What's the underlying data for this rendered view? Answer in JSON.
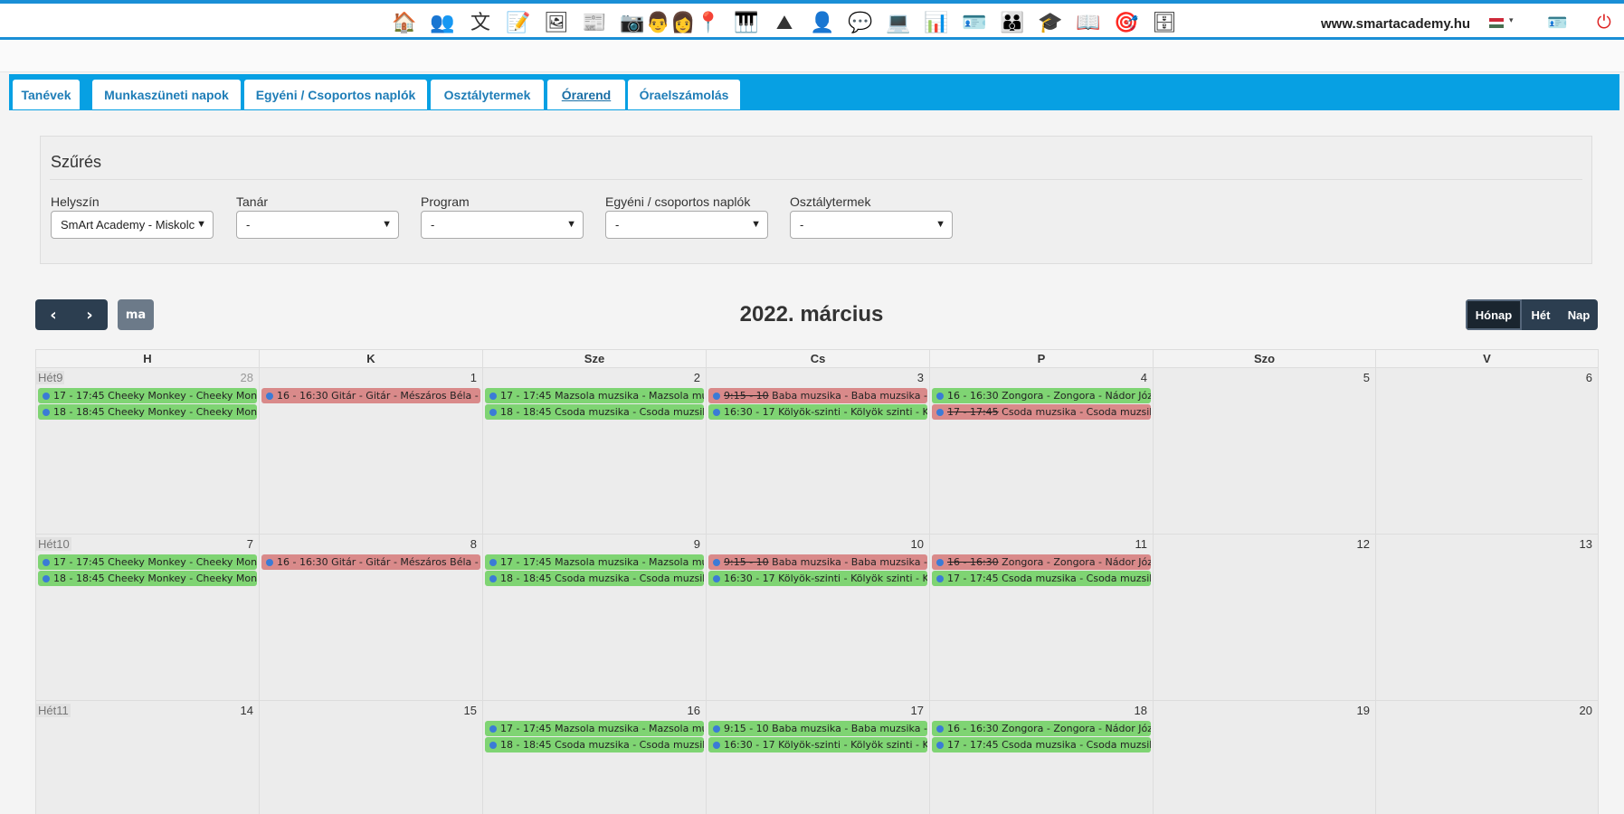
{
  "header": {
    "site": "www.smartacademy.hu",
    "apps": [
      {
        "icon": "school-icon",
        "glyph": "🏠"
      },
      {
        "icon": "users-icon",
        "glyph": "👥"
      },
      {
        "icon": "translate-icon",
        "glyph": "文"
      },
      {
        "icon": "documents-icon",
        "glyph": "📝"
      },
      {
        "icon": "slideshow-icon",
        "glyph": "🖼"
      },
      {
        "icon": "newspaper-icon",
        "glyph": "📰"
      },
      {
        "icon": "camera-icon",
        "glyph": "📷"
      },
      {
        "icon": "user-group-icon",
        "glyph": "👨‍👩"
      },
      {
        "icon": "location-pin-icon",
        "glyph": "📍"
      },
      {
        "icon": "piano-icon",
        "glyph": "🎹"
      },
      {
        "icon": "landscape-icon",
        "glyph": "⛰"
      },
      {
        "icon": "user-outline-icon",
        "glyph": "👤"
      },
      {
        "icon": "chat-bubble-icon",
        "glyph": "💬"
      },
      {
        "icon": "computer-user-icon",
        "glyph": "💻"
      },
      {
        "icon": "presentation-icon",
        "glyph": "📊"
      },
      {
        "icon": "id-badge-icon",
        "glyph": "🪪"
      },
      {
        "icon": "family-icon",
        "glyph": "👪"
      },
      {
        "icon": "graduate-icon",
        "glyph": "🎓"
      },
      {
        "icon": "book-icon",
        "glyph": "📖"
      },
      {
        "icon": "target-icon",
        "glyph": "🎯"
      },
      {
        "icon": "database-icon",
        "glyph": "🗄"
      }
    ],
    "flag_colors": [
      "#ce2939",
      "#ffffff",
      "#477050"
    ],
    "idcard_glyph": "🪪",
    "power_glyph": "⏻",
    "caret_glyph": "▾"
  },
  "tabs": [
    {
      "label": "Tanévek",
      "active": false
    },
    {
      "label": "Munkaszüneti napok",
      "active": false
    },
    {
      "label": "Egyéni / Csoportos naplók",
      "active": false
    },
    {
      "label": "Osztálytermek",
      "active": false
    },
    {
      "label": "Órarend",
      "active": true
    },
    {
      "label": "Óraelszámolás",
      "active": false
    }
  ],
  "filter": {
    "title": "Szűrés",
    "fields": [
      {
        "label": "Helyszín",
        "value": "SmArt Academy - Miskolc"
      },
      {
        "label": "Tanár",
        "value": "-"
      },
      {
        "label": "Program",
        "value": "-"
      },
      {
        "label": "Egyéni / csoportos naplók",
        "value": "-"
      },
      {
        "label": "Osztálytermek",
        "value": "-"
      }
    ]
  },
  "toolbar": {
    "prev_glyph": "‹",
    "next_glyph": "›",
    "today_label": "ma",
    "title": "2022. március",
    "views": [
      {
        "label": "Hónap",
        "active": true
      },
      {
        "label": "Hét",
        "active": false
      },
      {
        "label": "Nap",
        "active": false
      }
    ]
  },
  "calendar": {
    "weekdays": [
      "H",
      "K",
      "Sze",
      "Cs",
      "P",
      "Szo",
      "V"
    ],
    "weeks": [
      {
        "label": "Hét9",
        "days": [
          "28",
          "1",
          "2",
          "3",
          "4",
          "5",
          "6"
        ],
        "other_month": [
          true,
          false,
          false,
          false,
          false,
          false,
          false
        ],
        "events": [
          [
            {
              "time": "17 - 17:45",
              "title": "Cheeky Monkey - Cheeky Monkey",
              "color": "green",
              "cancelled": false
            },
            {
              "time": "18 - 18:45",
              "title": "Cheeky Monkey - Cheeky Monkey",
              "color": "green",
              "cancelled": false
            }
          ],
          [
            {
              "time": "16 - 16:30",
              "title": "Gitár - Gitár - Mészáros Béla - Gitár",
              "color": "red",
              "cancelled": false
            }
          ],
          [
            {
              "time": "17 - 17:45",
              "title": "Mazsola muzsika - Mazsola muzsika",
              "color": "green",
              "cancelled": false
            },
            {
              "time": "18 - 18:45",
              "title": "Csoda muzsika - Csoda muzsika",
              "color": "green",
              "cancelled": false
            }
          ],
          [
            {
              "time": "9:15 - 10",
              "title": "Baba muzsika - Baba muzsika - Baba",
              "color": "red",
              "cancelled": true
            },
            {
              "time": "16:30 - 17",
              "title": "Kölyök-szinti - Kölyök szinti - Kölyök",
              "color": "green",
              "cancelled": false
            }
          ],
          [
            {
              "time": "16 - 16:30",
              "title": "Zongora - Zongora - Nádor József",
              "color": "green",
              "cancelled": false
            },
            {
              "time": "17 - 17:45",
              "title": "Csoda muzsika - Csoda muzsika",
              "color": "red",
              "cancelled": true
            }
          ],
          [],
          []
        ]
      },
      {
        "label": "Hét10",
        "days": [
          "7",
          "8",
          "9",
          "10",
          "11",
          "12",
          "13"
        ],
        "other_month": [
          false,
          false,
          false,
          false,
          false,
          false,
          false
        ],
        "events": [
          [
            {
              "time": "17 - 17:45",
              "title": "Cheeky Monkey - Cheeky Monkey",
              "color": "green",
              "cancelled": false
            },
            {
              "time": "18 - 18:45",
              "title": "Cheeky Monkey - Cheeky Monkey",
              "color": "green",
              "cancelled": false
            }
          ],
          [
            {
              "time": "16 - 16:30",
              "title": "Gitár - Gitár - Mészáros Béla - Gitár",
              "color": "red",
              "cancelled": false
            }
          ],
          [
            {
              "time": "17 - 17:45",
              "title": "Mazsola muzsika - Mazsola muzsika",
              "color": "green",
              "cancelled": false
            },
            {
              "time": "18 - 18:45",
              "title": "Csoda muzsika - Csoda muzsika",
              "color": "green",
              "cancelled": false
            }
          ],
          [
            {
              "time": "9:15 - 10",
              "title": "Baba muzsika - Baba muzsika - Baba",
              "color": "red",
              "cancelled": true
            },
            {
              "time": "16:30 - 17",
              "title": "Kölyök-szinti - Kölyök szinti - Kölyök",
              "color": "green",
              "cancelled": false
            }
          ],
          [
            {
              "time": "16 - 16:30",
              "title": "Zongora - Zongora - Nádor József",
              "color": "red",
              "cancelled": true
            },
            {
              "time": "17 - 17:45",
              "title": "Csoda muzsika - Csoda muzsika",
              "color": "green",
              "cancelled": false
            }
          ],
          [],
          []
        ]
      },
      {
        "label": "Hét11",
        "days": [
          "14",
          "15",
          "16",
          "17",
          "18",
          "19",
          "20"
        ],
        "other_month": [
          false,
          false,
          false,
          false,
          false,
          false,
          false
        ],
        "events": [
          [],
          [],
          [
            {
              "time": "17 - 17:45",
              "title": "Mazsola muzsika - Mazsola muzsika",
              "color": "green",
              "cancelled": false
            },
            {
              "time": "18 - 18:45",
              "title": "Csoda muzsika - Csoda muzsika",
              "color": "green",
              "cancelled": false
            }
          ],
          [
            {
              "time": "9:15 - 10",
              "title": "Baba muzsika - Baba muzsika - Baba",
              "color": "green",
              "cancelled": false
            },
            {
              "time": "16:30 - 17",
              "title": "Kölyök-szinti - Kölyök szinti - Kölyök",
              "color": "green",
              "cancelled": false
            }
          ],
          [
            {
              "time": "16 - 16:30",
              "title": "Zongora - Zongora - Nádor József",
              "color": "green",
              "cancelled": false
            },
            {
              "time": "17 - 17:45",
              "title": "Csoda muzsika - Csoda muzsika",
              "color": "green",
              "cancelled": false
            }
          ],
          [],
          []
        ]
      }
    ]
  }
}
